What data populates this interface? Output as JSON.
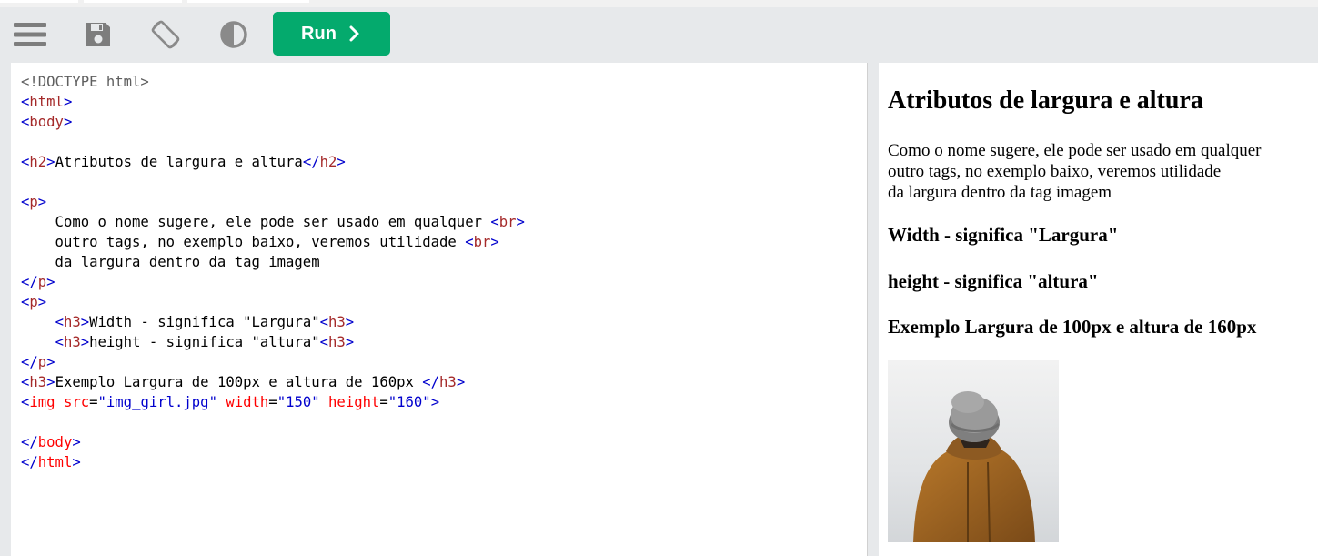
{
  "toolbar": {
    "menu_icon": "hamburger-menu-icon",
    "save_icon": "floppy-disk-icon",
    "rotate_icon": "rotate-screen-icon",
    "theme_icon": "contrast-icon",
    "run_label": "Run",
    "run_color": "#04aa6d"
  },
  "editor": {
    "lines": [
      [
        "<!DOCTYPE html>"
      ],
      [
        "<",
        "html",
        ">"
      ],
      [
        "<",
        "body",
        ">"
      ],
      [],
      [
        "<",
        "h2",
        ">",
        "Atributos de largura e altura",
        "</",
        "h2",
        ">"
      ],
      [],
      [
        "<",
        "p",
        ">"
      ],
      [
        "    Como o nome sugere, ele pode ser usado em qualquer ",
        "<",
        "br",
        ">"
      ],
      [
        "    outro tags, no exemplo baixo, veremos utilidade ",
        "<",
        "br",
        ">"
      ],
      [
        "    da largura dentro da tag imagem"
      ],
      [
        "</",
        "p",
        ">"
      ],
      [
        "<",
        "p",
        ">"
      ],
      [
        "    ",
        "<",
        "h3",
        ">",
        "Width - significa \"Largura\"",
        "<",
        "h3",
        ">"
      ],
      [
        "    ",
        "<",
        "h3",
        ">",
        "height - significa \"altura\"",
        "<",
        "h3",
        ">"
      ],
      [
        "</",
        "p",
        ">"
      ],
      [
        "<",
        "h3",
        ">",
        "Exemplo Largura de 100px e altura de 160px ",
        "</",
        "h3",
        ">"
      ],
      [
        "<",
        "img",
        " src",
        "=",
        "\"img_girl.jpg\"",
        " width",
        "=",
        "\"150\"",
        " height",
        "=",
        "\"160\"",
        ">"
      ],
      [],
      [
        "</",
        "body",
        ">"
      ],
      [
        "</",
        "html",
        ">"
      ]
    ]
  },
  "result": {
    "h2": "Atributos de largura e altura",
    "p_lines": [
      "Como o nome sugere, ele pode ser usado em qualquer",
      "outro tags, no exemplo baixo, veremos utilidade",
      "da largura dentro da tag imagem"
    ],
    "h3_width": "Width - significa \"Largura\"",
    "h3_height": "height - significa \"altura\"",
    "h3_example": "Exemplo Largura de 100px e altura de 160px"
  }
}
